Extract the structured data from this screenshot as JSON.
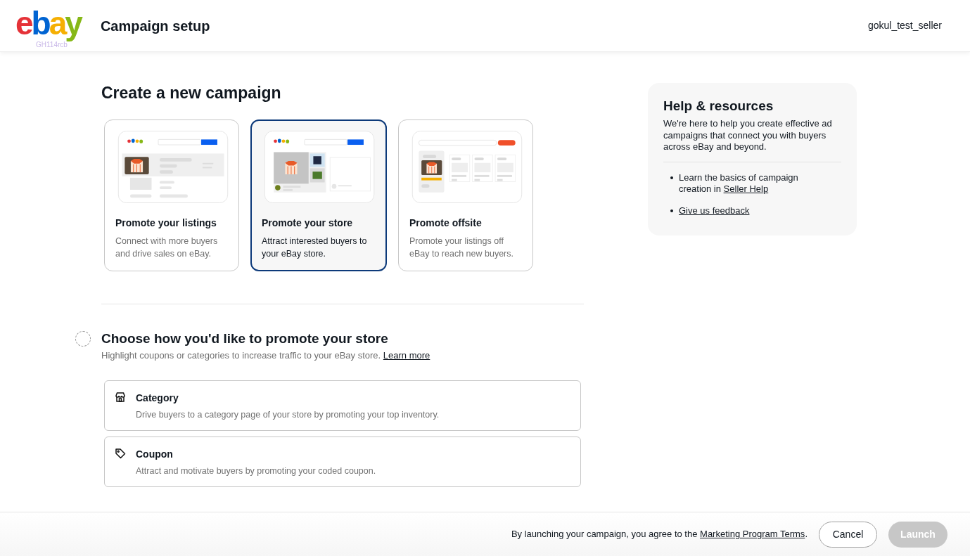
{
  "header": {
    "logo": [
      {
        "char": "e",
        "color": "#e53238"
      },
      {
        "char": "b",
        "color": "#0064d2"
      },
      {
        "char": "a",
        "color": "#f5af02"
      },
      {
        "char": "y",
        "color": "#86b817"
      }
    ],
    "env_tag": "GH114rcb",
    "title": "Campaign setup",
    "user": "gokul_test_seller"
  },
  "main": {
    "heading": "Create a new campaign",
    "campaign_types": [
      {
        "kind": "listings",
        "title": "Promote your listings",
        "description": "Connect with more buyers and drive sales on eBay.",
        "selected": false
      },
      {
        "kind": "store",
        "title": "Promote your store",
        "description": "Attract interested buyers to your eBay store.",
        "selected": true
      },
      {
        "kind": "offsite",
        "title": "Promote offsite",
        "description": "Promote your listings off eBay to reach new buyers.",
        "selected": false
      }
    ],
    "step": {
      "title": "Choose how you'd like to promote your store",
      "subtitle": "Highlight coupons or categories to increase traffic to your eBay store.",
      "link": "Learn more",
      "options": [
        {
          "kind": "category",
          "title": "Category",
          "description": "Drive buyers to a category page of your store by promoting your top inventory."
        },
        {
          "kind": "coupon",
          "title": "Coupon",
          "description": "Attract and motivate buyers by promoting your coded coupon."
        }
      ]
    }
  },
  "help": {
    "title": "Help & resources",
    "intro": "We're here to help you create effective ad campaigns that connect you with buyers across eBay and beyond.",
    "items": [
      {
        "text": "Learn the basics of campaign creation in ",
        "link": "Seller Help"
      },
      {
        "link": "Give us feedback"
      }
    ]
  },
  "footer": {
    "notice": "By launching your campaign, you agree to the ",
    "link": "Marketing Program Terms",
    "notice_end": ".",
    "buttons": [
      {
        "label": "Cancel",
        "disabled": false,
        "kind": "secondary"
      },
      {
        "label": "Launch",
        "disabled": true,
        "kind": "primary"
      }
    ]
  }
}
